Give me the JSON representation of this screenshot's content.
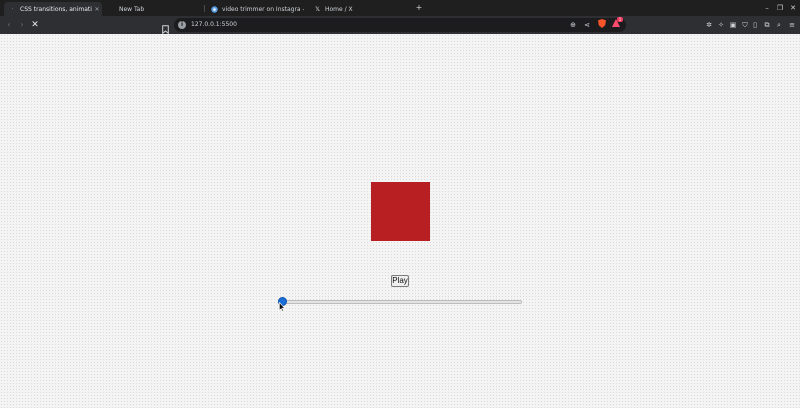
{
  "browser": {
    "tabs": [
      {
        "title": "CSS transitions, animations",
        "favicon": "page-icon",
        "active": true
      },
      {
        "title": "New Tab",
        "favicon": "",
        "active": false
      },
      {
        "title": "video trimmer on Instagra - Gi",
        "favicon": "globe-icon",
        "active": false
      },
      {
        "title": "Home / X",
        "favicon": "x-icon",
        "active": false
      }
    ],
    "new_tab_label": "+",
    "url": "127.0.0.1:5500",
    "rewards_badge": "1",
    "icons": {
      "back": "‹",
      "forward": "›",
      "stop": "✕",
      "zoom": "⊕",
      "share": "⋖",
      "sidebar": "▯",
      "wallet": "▣",
      "menu": "≡"
    },
    "window_controls": {
      "minimize": "–",
      "restore": "❐",
      "close": "✕"
    }
  },
  "page": {
    "play_label": "Play",
    "slider_value": 0,
    "accent_color": "#1a6ed8",
    "square_color": "#b71f23"
  }
}
